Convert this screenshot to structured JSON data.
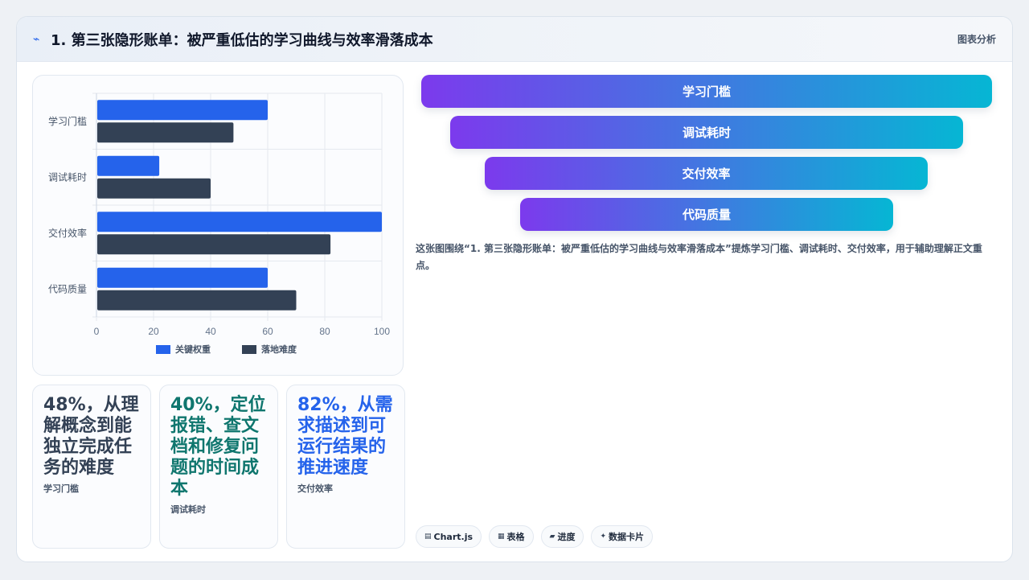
{
  "header": {
    "icon": "trend-icon",
    "title": "1. 第三张隐形账单：被严重低估的学习曲线与效率滑落成本",
    "tag": "图表分析"
  },
  "colors": {
    "series_primary": "#2563eb",
    "series_secondary": "#334155",
    "funnel_start": "#7c3aed",
    "funnel_end": "#06b6d4",
    "stat_1": "#334155",
    "stat_2": "#0f766e",
    "stat_3": "#2563eb"
  },
  "chart_data": {
    "type": "bar",
    "orientation": "horizontal",
    "categories": [
      "学习门槛",
      "调试耗时",
      "交付效率",
      "代码质量"
    ],
    "series": [
      {
        "name": "关键权重",
        "values": [
          60,
          22,
          100,
          60
        ]
      },
      {
        "name": "落地难度",
        "values": [
          48,
          40,
          82,
          70
        ]
      }
    ],
    "xlim": [
      0,
      100
    ],
    "xticks": [
      0,
      20,
      40,
      60,
      80,
      100
    ],
    "grid": true,
    "legend": "bottom"
  },
  "stats": [
    {
      "value": "48%，从理解概念到能独立完成任务的难度",
      "label": "学习门槛"
    },
    {
      "value": "40%，定位报错、查文档和修复问题的时间成本",
      "label": "调试耗时"
    },
    {
      "value": "82%，从需求描述到可运行结果的推进速度",
      "label": "交付效率"
    }
  ],
  "funnel": [
    "学习门槛",
    "调试耗时",
    "交付效率",
    "代码质量"
  ],
  "summary": "这张图围绕“1. 第三张隐形账单：被严重低估的学习曲线与效率滑落成本”提炼学习门槛、调试耗时、交付效率，用于辅助理解正文重点。",
  "tags": [
    {
      "icon": "chart-icon",
      "glyph": "▤",
      "label": "Chart.js"
    },
    {
      "icon": "table-icon",
      "glyph": "▦",
      "label": "表格"
    },
    {
      "icon": "progress-icon",
      "glyph": "▰",
      "label": "进度"
    },
    {
      "icon": "sparkle-icon",
      "glyph": "✦",
      "label": "数据卡片"
    }
  ]
}
